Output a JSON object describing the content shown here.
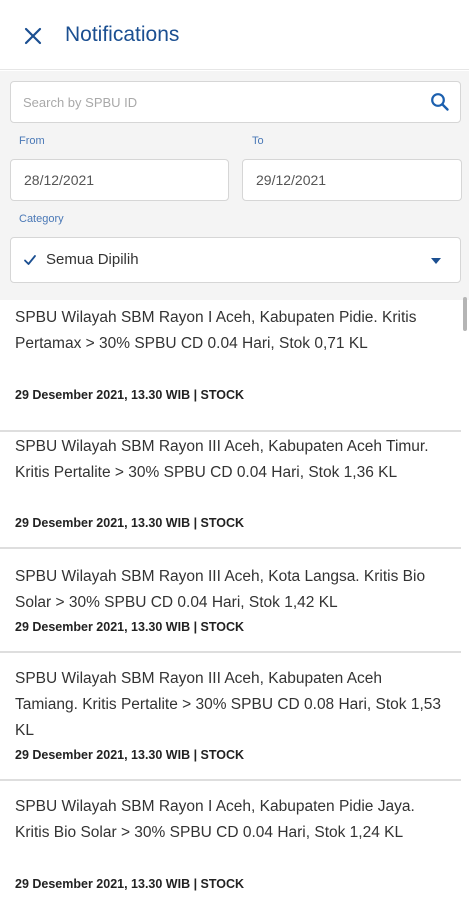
{
  "header": {
    "title": "Notifications",
    "close_icon": "close-icon"
  },
  "filters": {
    "search": {
      "placeholder": "Search by SPBU ID",
      "value": "",
      "icon": "search-icon"
    },
    "from_label": "From",
    "from_value": "28/12/2021",
    "to_label": "To",
    "to_value": "29/12/2021",
    "category_label": "Category",
    "category_value": "Semua Dipilih",
    "category_icon": "check-icon",
    "dropdown_icon": "chevron-down-icon"
  },
  "colors": {
    "title": "#1b4f91",
    "label": "#4a78b6",
    "filter_background": "#f4f4f4"
  },
  "notifications": [
    {
      "text": "SPBU Wilayah SBM Rayon I Aceh, Kabupaten Pidie. Kritis Pertamax > 30% SPBU CD 0.04 Hari, Stok 0,71 KL",
      "meta": "29 Desember 2021, 13.30 WIB | STOCK"
    },
    {
      "text": "SPBU Wilayah SBM Rayon III Aceh, Kabupaten Aceh Timur. Kritis Pertalite > 30% SPBU CD 0.04 Hari, Stok 1,36 KL",
      "meta": "29 Desember 2021, 13.30 WIB | STOCK"
    },
    {
      "text": "SPBU Wilayah SBM Rayon III Aceh, Kota Langsa. Kritis Bio Solar > 30% SPBU CD 0.04 Hari, Stok 1,42 KL",
      "meta": "29 Desember 2021, 13.30 WIB | STOCK"
    },
    {
      "text": "SPBU Wilayah SBM Rayon III Aceh, Kabupaten Aceh Tamiang. Kritis Pertalite > 30% SPBU CD 0.08 Hari, Stok 1,53 KL",
      "meta": "29 Desember 2021, 13.30 WIB | STOCK"
    },
    {
      "text": "SPBU Wilayah SBM Rayon I Aceh, Kabupaten Pidie Jaya. Kritis Bio Solar > 30% SPBU CD 0.04 Hari, Stok 1,24 KL",
      "meta": "29 Desember 2021, 13.30 WIB | STOCK"
    }
  ]
}
